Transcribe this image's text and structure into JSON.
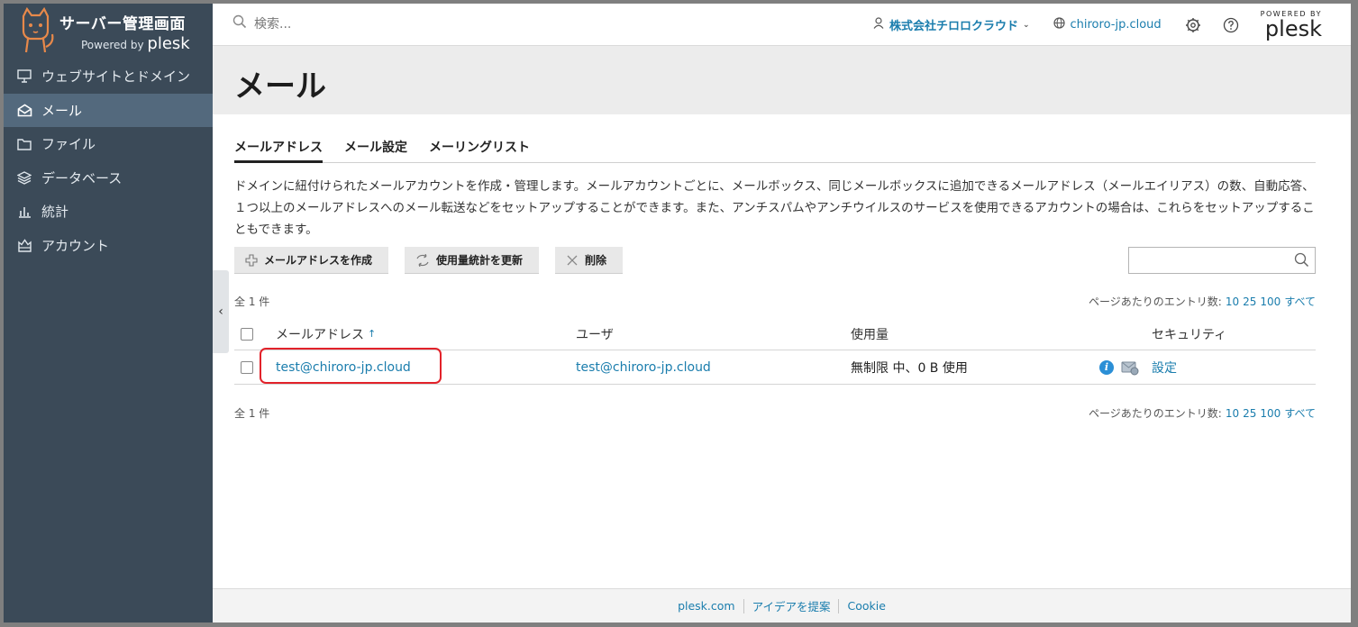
{
  "app": {
    "title": "サーバー管理画面",
    "powered_prefix": "Powered by",
    "powered_brand": "plesk"
  },
  "sidebar": {
    "items": [
      {
        "label": "ウェブサイトとドメイン",
        "icon": "monitor-icon"
      },
      {
        "label": "メール",
        "icon": "envelope-icon",
        "active": true
      },
      {
        "label": "ファイル",
        "icon": "folder-icon"
      },
      {
        "label": "データベース",
        "icon": "database-icon"
      },
      {
        "label": "統計",
        "icon": "bar-chart-icon"
      },
      {
        "label": "アカウント",
        "icon": "account-icon"
      }
    ]
  },
  "topbar": {
    "search_placeholder": "検索...",
    "account": "株式会社チロロクラウド",
    "domain": "chiroro-jp.cloud",
    "powered_label": "POWERED BY",
    "brand": "plesk"
  },
  "page": {
    "title": "メール",
    "tabs": [
      {
        "label": "メールアドレス",
        "active": true
      },
      {
        "label": "メール設定"
      },
      {
        "label": "メーリングリスト"
      }
    ],
    "description": "ドメインに紐付けられたメールアカウントを作成・管理します。メールアカウントごとに、メールボックス、同じメールボックスに追加できるメールアドレス（メールエイリアス）の数、自動応答、１つ以上のメールアドレスへのメール転送などをセットアップすることができます。また、アンチスパムやアンチウイルスのサービスを使用できるアカウントの場合は、これらをセットアップすることもできます。"
  },
  "toolbar": {
    "create_label": "メールアドレスを作成",
    "refresh_label": "使用量統計を更新",
    "delete_label": "削除"
  },
  "list": {
    "count_label": "全 1 件",
    "perpage_label": "ページあたりのエントリ数:",
    "perpage_options": [
      "10",
      "25",
      "100",
      "すべて"
    ],
    "columns": {
      "email": "メールアドレス",
      "sort_indicator": "↑",
      "user": "ユーザ",
      "usage": "使用量",
      "security": "セキュリティ"
    },
    "rows": [
      {
        "email": "test@chiroro-jp.cloud",
        "user": "test@chiroro-jp.cloud",
        "usage": "無制限 中、0 B 使用",
        "security_link": "設定"
      }
    ]
  },
  "footer": {
    "links": [
      "plesk.com",
      "アイデアを提案",
      "Cookie"
    ]
  },
  "colors": {
    "sidebar_bg": "#3b4a58",
    "sidebar_active": "#53697d",
    "link": "#1a7dad",
    "highlight": "#e2222a"
  }
}
